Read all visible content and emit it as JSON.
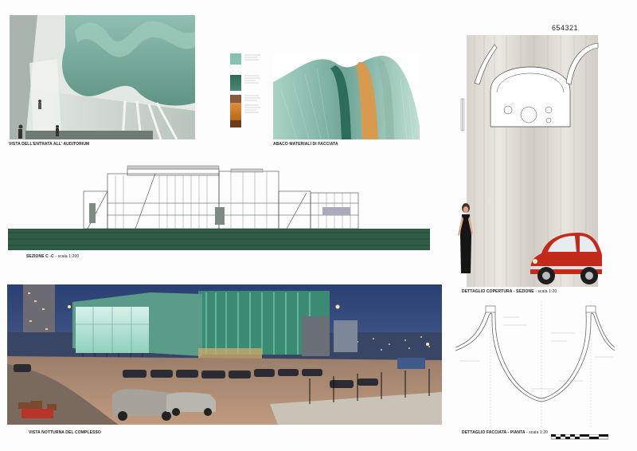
{
  "sheet_number": "654321",
  "captions": {
    "auditorium": "VISTA DELL'ENTRATA ALL' AUDITORIUM",
    "materials": "ABACO MATERIALI DI FACCIATA",
    "section_title": "SEZIONE C -C",
    "section_scale": "- scala 1:200",
    "roof_title": "DETTAGLIO COPERTURA - SEZIONE",
    "roof_scale": "- scala 1:20",
    "night": "VISTA NOTTURNA DEL COMPLESSO",
    "facade_title": "DETTAGLIO FACCIATA - PIANTA",
    "facade_scale": "- scala 1:20"
  },
  "colors": {
    "panel_green": "#7fb5a8",
    "dark_green": "#2f5b4a",
    "copper": "#c8761f",
    "night_sky": "#2c3f6e",
    "red_car": "#c42a1c"
  }
}
